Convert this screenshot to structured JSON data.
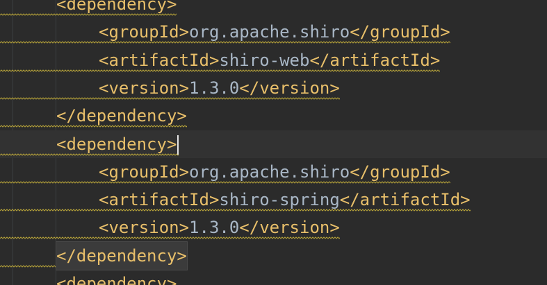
{
  "editor": {
    "language": "xml",
    "lines": [
      {
        "indent": 1,
        "open": "<dependency>",
        "text": "",
        "close": ""
      },
      {
        "indent": 2,
        "open": "<groupId>",
        "text": "org.apache.shiro",
        "close": "</groupId>"
      },
      {
        "indent": 2,
        "open": "<artifactId>",
        "text": "shiro-web",
        "close": "</artifactId>"
      },
      {
        "indent": 2,
        "open": "<version>",
        "text": "1.3.0",
        "close": "</version>"
      },
      {
        "indent": 1,
        "open": "</dependency>",
        "text": "",
        "close": ""
      },
      {
        "indent": 1,
        "open": "<dependency>",
        "text": "",
        "close": "",
        "current": true,
        "caret": true
      },
      {
        "indent": 2,
        "open": "<groupId>",
        "text": "org.apache.shiro",
        "close": "</groupId>"
      },
      {
        "indent": 2,
        "open": "<artifactId>",
        "text": "shiro-spring",
        "close": "</artifactId>"
      },
      {
        "indent": 2,
        "open": "<version>",
        "text": "1.3.0",
        "close": "</version>"
      },
      {
        "indent": 1,
        "open": "</dependency>",
        "text": "",
        "close": "",
        "matched": true
      },
      {
        "indent": 1,
        "open": "<dependency>",
        "text": "",
        "close": ""
      }
    ],
    "colors": {
      "background": "#2b2b2b",
      "current_line": "#323232",
      "tag": "#e8bf6a",
      "text": "#a9b7c6",
      "warning_squiggle": "#b5a23a"
    }
  }
}
